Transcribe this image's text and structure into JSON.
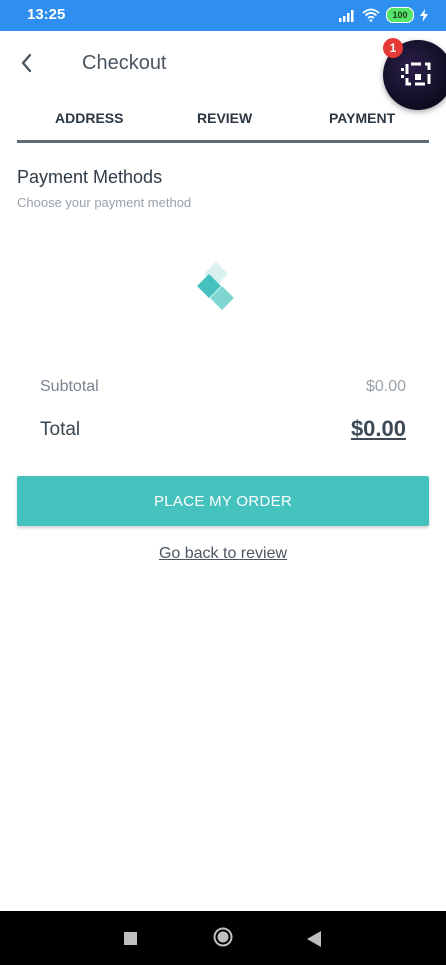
{
  "status_bar": {
    "time": "13:25",
    "battery": "100",
    "icons": [
      "signal-icon",
      "wifi-icon",
      "battery-icon",
      "charging-icon"
    ]
  },
  "header": {
    "title": "Checkout",
    "back_icon": "chevron-left-icon"
  },
  "floating_widget": {
    "badge_count": "1",
    "icon": "app-logo-icon"
  },
  "tabs": [
    {
      "label": "ADDRESS"
    },
    {
      "label": "REVIEW"
    },
    {
      "label": "PAYMENT"
    }
  ],
  "payment_methods": {
    "title": "Payment Methods",
    "subtitle": "Choose your payment method",
    "loader_icon": "diamond-loader-icon"
  },
  "totals": {
    "subtotal_label": "Subtotal",
    "subtotal_value": "$0.00",
    "total_label": "Total",
    "total_value": "$0.00"
  },
  "actions": {
    "place_order_label": "PLACE MY ORDER",
    "go_back_label": "Go back to review"
  },
  "colors": {
    "status_bar": "#2f8ff0",
    "accent": "#45c2bd",
    "text": "#3f4a55"
  },
  "nav_bar": {
    "icons": [
      "recents-square-icon",
      "home-circle-icon",
      "back-triangle-icon"
    ]
  }
}
